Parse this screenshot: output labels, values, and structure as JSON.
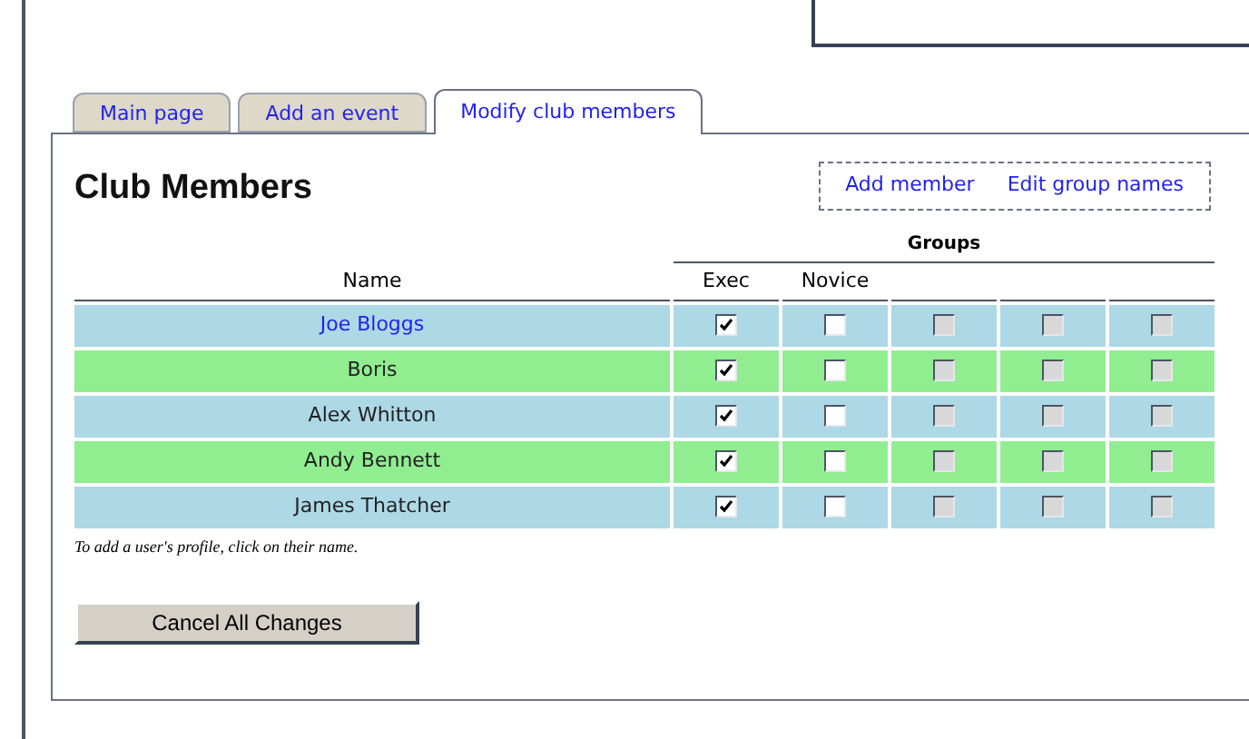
{
  "tabs": [
    {
      "label": "Main page",
      "selected": false
    },
    {
      "label": "Add an event",
      "selected": false
    },
    {
      "label": "Modify club members",
      "selected": true
    }
  ],
  "panel": {
    "title": "Club Members",
    "links": [
      "Add member",
      "Edit group names"
    ],
    "table": {
      "group_heading": "Groups",
      "name_heading": "Name",
      "group_columns": [
        "Exec",
        "Novice"
      ],
      "rows": [
        {
          "name": "Joe Bloggs",
          "kind": "link",
          "color": "#add8e6",
          "groups": [
            {
              "checked": true,
              "disabled": false
            },
            {
              "checked": false,
              "disabled": false
            },
            {
              "checked": false,
              "disabled": true
            },
            {
              "checked": false,
              "disabled": true
            },
            {
              "checked": false,
              "disabled": true
            }
          ]
        },
        {
          "name": "Boris",
          "kind": "text",
          "color": "#90ee90",
          "groups": [
            {
              "checked": true,
              "disabled": false
            },
            {
              "checked": false,
              "disabled": false
            },
            {
              "checked": false,
              "disabled": true
            },
            {
              "checked": false,
              "disabled": true
            },
            {
              "checked": false,
              "disabled": true
            }
          ]
        },
        {
          "name": "Alex Whitton",
          "kind": "text",
          "color": "#add8e6",
          "groups": [
            {
              "checked": true,
              "disabled": false
            },
            {
              "checked": false,
              "disabled": false
            },
            {
              "checked": false,
              "disabled": true
            },
            {
              "checked": false,
              "disabled": true
            },
            {
              "checked": false,
              "disabled": true
            }
          ]
        },
        {
          "name": "Andy Bennett",
          "kind": "text",
          "color": "#90ee90",
          "groups": [
            {
              "checked": true,
              "disabled": false
            },
            {
              "checked": false,
              "disabled": false
            },
            {
              "checked": false,
              "disabled": true
            },
            {
              "checked": false,
              "disabled": true
            },
            {
              "checked": false,
              "disabled": true
            }
          ]
        },
        {
          "name": "James Thatcher",
          "kind": "text",
          "color": "#add8e6",
          "groups": [
            {
              "checked": true,
              "disabled": false
            },
            {
              "checked": false,
              "disabled": false
            },
            {
              "checked": false,
              "disabled": true
            },
            {
              "checked": false,
              "disabled": true
            },
            {
              "checked": false,
              "disabled": true
            }
          ]
        }
      ]
    },
    "note": "To add a user's profile, click on their name.",
    "button": "Cancel All Changes"
  }
}
